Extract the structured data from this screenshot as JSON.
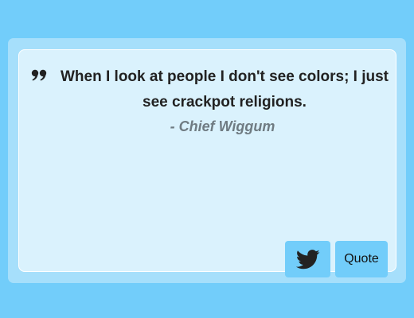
{
  "quote": {
    "text": "When I look at people I don't see colors; I just see crackpot religions.",
    "author": "- Chief Wiggum"
  },
  "buttons": {
    "twitter_icon": "twitter-icon",
    "quote_label": "Quote"
  },
  "colors": {
    "page_background": "#72cdfa",
    "outer_card": "#a6dffb",
    "inner_card": "#daf2fd",
    "button": "#72cdfa",
    "quote_text": "#222222",
    "author_text": "#6f7b82"
  }
}
